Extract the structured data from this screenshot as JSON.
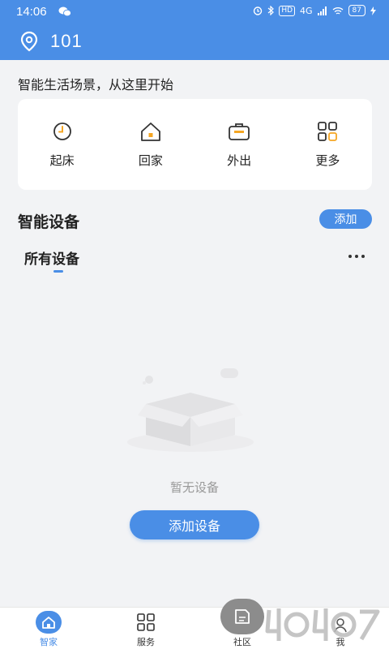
{
  "status_bar": {
    "time": "14:06",
    "signal": "4G",
    "hd": "HD",
    "battery": "87"
  },
  "header": {
    "location_label": "101"
  },
  "scenes": {
    "title": "智能生活场景，从这里开始",
    "items": [
      {
        "label": "起床",
        "icon": "clock-icon"
      },
      {
        "label": "回家",
        "icon": "home-icon"
      },
      {
        "label": "外出",
        "icon": "briefcase-icon"
      },
      {
        "label": "更多",
        "icon": "grid-icon"
      }
    ]
  },
  "devices": {
    "title": "智能设备",
    "add_label": "添加",
    "tab_all": "所有设备",
    "empty_text": "暂无设备",
    "add_device_label": "添加设备"
  },
  "bottom_nav": {
    "items": [
      {
        "label": "智家",
        "icon": "home-icon",
        "active": true
      },
      {
        "label": "服务",
        "icon": "grid-icon",
        "active": false
      },
      {
        "label": "社区",
        "icon": "community-icon",
        "active": false
      },
      {
        "label": "我",
        "icon": "user-icon",
        "active": false
      }
    ]
  },
  "colors": {
    "accent": "#4a8ee6",
    "background": "#f2f3f5",
    "card": "#ffffff",
    "scene_icon_stroke": "#333333",
    "scene_icon_accent": "#f5a623"
  }
}
